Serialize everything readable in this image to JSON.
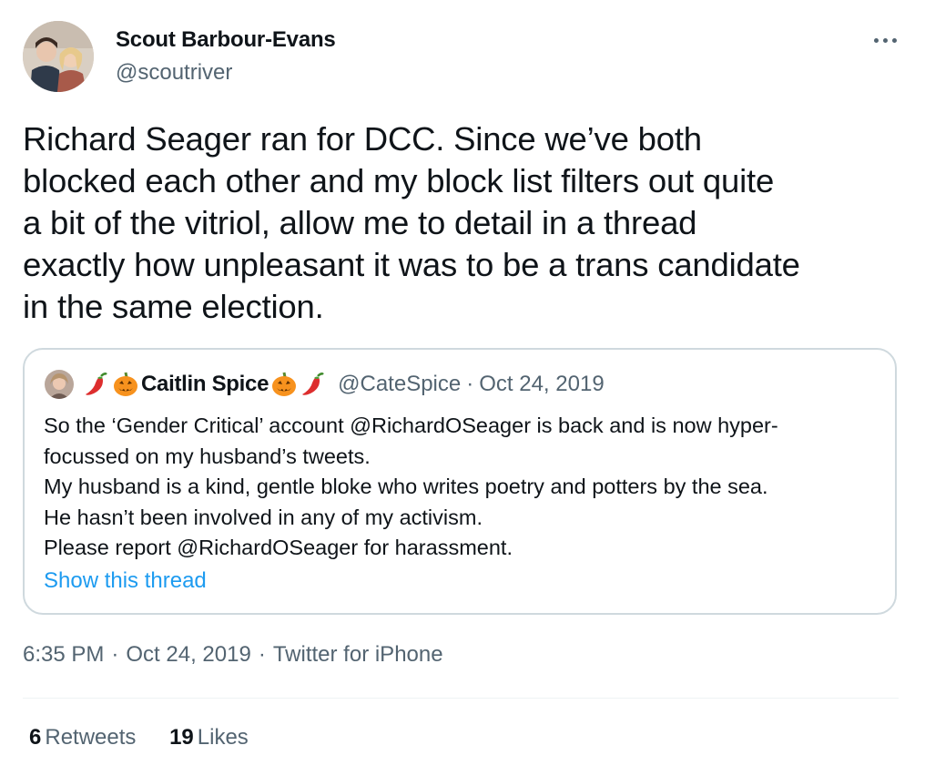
{
  "author": {
    "name": "Scout Barbour-Evans",
    "handle": "@scoutriver"
  },
  "tweet": {
    "text": "Richard Seager ran for DCC. Since we’ve both\nblocked each other and my block list filters out quite\na bit of the vitriol, allow me to detail in a thread\nexactly how unpleasant it was to be a trans candidate\nin the same election."
  },
  "quote": {
    "name": "Caitlin Spice",
    "handle": "@CateSpice",
    "separator": "·",
    "date": "Oct 24, 2019",
    "text": "So the ‘Gender Critical’ account @RichardOSeager is back and is now hyper-\nfocussed on my husband’s tweets.\nMy husband is a kind, gentle bloke who writes poetry and potters by the sea.\nHe hasn’t been involved in any of my activism.\nPlease report @RichardOSeager for harassment.",
    "link_label": "Show this thread"
  },
  "meta": {
    "time": "6:35 PM",
    "separator": "·",
    "date": "Oct 24, 2019",
    "source": "Twitter for iPhone"
  },
  "stats": {
    "retweets_count": "6",
    "retweets_label": "Retweets",
    "likes_count": "19",
    "likes_label": "Likes"
  },
  "icons": {
    "more": "more-horizontal-icon",
    "pepper": "chili-pepper-emoji",
    "pumpkin": "jack-o-lantern-emoji"
  },
  "colors": {
    "text": "#0f1419",
    "secondary": "#536471",
    "link": "#1d9bf0",
    "border": "#cfd9de"
  }
}
